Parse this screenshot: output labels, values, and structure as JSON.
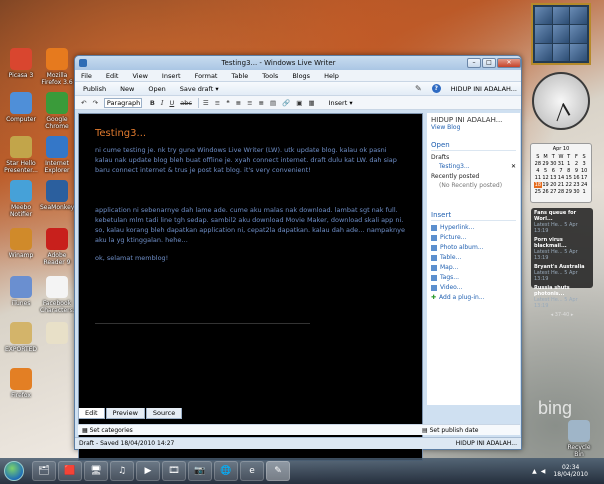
{
  "desktop_icons": [
    {
      "label": "Picasa 3",
      "color": "#d9462f"
    },
    {
      "label": "Mozilla Firefox 3.6",
      "color": "#e67a1e"
    },
    {
      "label": "Computer",
      "color": "#4f8fd8"
    },
    {
      "label": "Google Chrome",
      "color": "#3a9b3a"
    },
    {
      "label": "Star Hello Presenter...",
      "color": "#c2a54a"
    },
    {
      "label": "Internet Explorer",
      "color": "#3477c8"
    },
    {
      "label": "Meebo Notifier",
      "color": "#46a1d8"
    },
    {
      "label": "SeaMonkey",
      "color": "#2b5f9e"
    },
    {
      "label": "Winamp",
      "color": "#d08a2a"
    },
    {
      "label": "Adobe Reader 9",
      "color": "#c8201c"
    },
    {
      "label": "iTunes",
      "color": "#6a8fd0"
    },
    {
      "label": "Facebook Characters...",
      "color": "#f4f4f4"
    },
    {
      "label": "EXPORTED",
      "color": "#d3b46a"
    },
    {
      "label": "",
      "color": "#e8e0c8"
    },
    {
      "label": "Firefox",
      "color": "#e37f24"
    }
  ],
  "window": {
    "title": "Testing3... - Windows Live Writer",
    "controls": {
      "minimize": "–",
      "maximize": "□",
      "close": "✕"
    }
  },
  "menu": [
    "File",
    "Edit",
    "View",
    "Insert",
    "Format",
    "Table",
    "Tools",
    "Blogs",
    "Help"
  ],
  "commands": {
    "publish": "Publish",
    "new": "New",
    "open": "Open",
    "save_draft": "Save draft",
    "blog_name": "HIDUP INI ADALAH...",
    "help": "?"
  },
  "format": {
    "style_value": "Paragraph",
    "bold": "B",
    "italic": "I",
    "underline": "U",
    "strike": "abc",
    "insert": "Insert"
  },
  "post": {
    "title": "Testing3...",
    "paragraphs": [
      "ni cume testing je. nk try gune Windows Live Writer (LW). utk update blog. kalau ok pasni kalau nak update blog bleh buat offline je. xyah connect internet. draft dulu kat LW. dah siap baru connect internet & trus je post kat blog. it's very convenient!",
      "application ni sebenarnye dah lame ade. cume aku malas nak download. lambat sgt nak full. kebetulan mlm tadi line tgh sedap. sambil2 aku download Movie Maker, download skali app ni. so, kalau korang bleh dapatkan application ni, cepat2la dapatkan. kalau dah ade… nampaknye aku la yg ktinggalan. hehe…",
      "ok, selamat memblog!"
    ]
  },
  "editor_tabs": [
    "Edit",
    "Preview",
    "Source"
  ],
  "categories": {
    "label": "Set categories",
    "publish_date": "Set publish date"
  },
  "status": {
    "left": "Draft - Saved 18/04/2010 14:27",
    "right": "HIDUP INI ADALAH..."
  },
  "sidebar": {
    "blog_title": "HIDUP INI ADALAH...",
    "view_blog": "View Blog",
    "open_heading": "Open",
    "drafts_label": "Drafts",
    "draft_item": "Testing3...",
    "draft_close": "✕",
    "recent_label": "Recently posted",
    "recent_empty": "(No Recently posted)",
    "insert_heading": "Insert",
    "insert_items": [
      "Hyperlink...",
      "Picture...",
      "Photo album...",
      "Table...",
      "Map...",
      "Tags...",
      "Video..."
    ],
    "add_plugin": "Add a plug-in..."
  },
  "calendar": {
    "month": "Apr 10",
    "days": [
      "S",
      "M",
      "T",
      "W",
      "T",
      "F",
      "S",
      "28",
      "29",
      "30",
      "31",
      "1",
      "2",
      "3",
      "4",
      "5",
      "6",
      "7",
      "8",
      "9",
      "10",
      "11",
      "12",
      "13",
      "14",
      "15",
      "16",
      "17",
      "18",
      "19",
      "20",
      "21",
      "22",
      "23",
      "24",
      "25",
      "26",
      "27",
      "28",
      "29",
      "30",
      "1"
    ],
    "today": "18"
  },
  "news": {
    "items": [
      {
        "headline": "Fans queue for Worl...",
        "meta": "Latest He... 5 Apr 13:19"
      },
      {
        "headline": "Porn virus blackmail...",
        "meta": "Latest He... 5 Apr 13:19"
      },
      {
        "headline": "Bryant's Australia",
        "meta": "Latest He... 5 Apr 13:19"
      },
      {
        "headline": "Russia shuts photonis...",
        "meta": "Latest He... 5 Apr 13:19"
      }
    ],
    "pager": "37-40"
  },
  "bing_watermark": "bing",
  "recycle_label": "Recycle Bin",
  "taskbar": {
    "apps": [
      "🗂",
      "🟥",
      "🖥",
      "♫",
      "▶",
      "🎞",
      "📷",
      "🌐",
      "e",
      "✎"
    ],
    "time": "02:34",
    "date": "18/04/2010"
  }
}
